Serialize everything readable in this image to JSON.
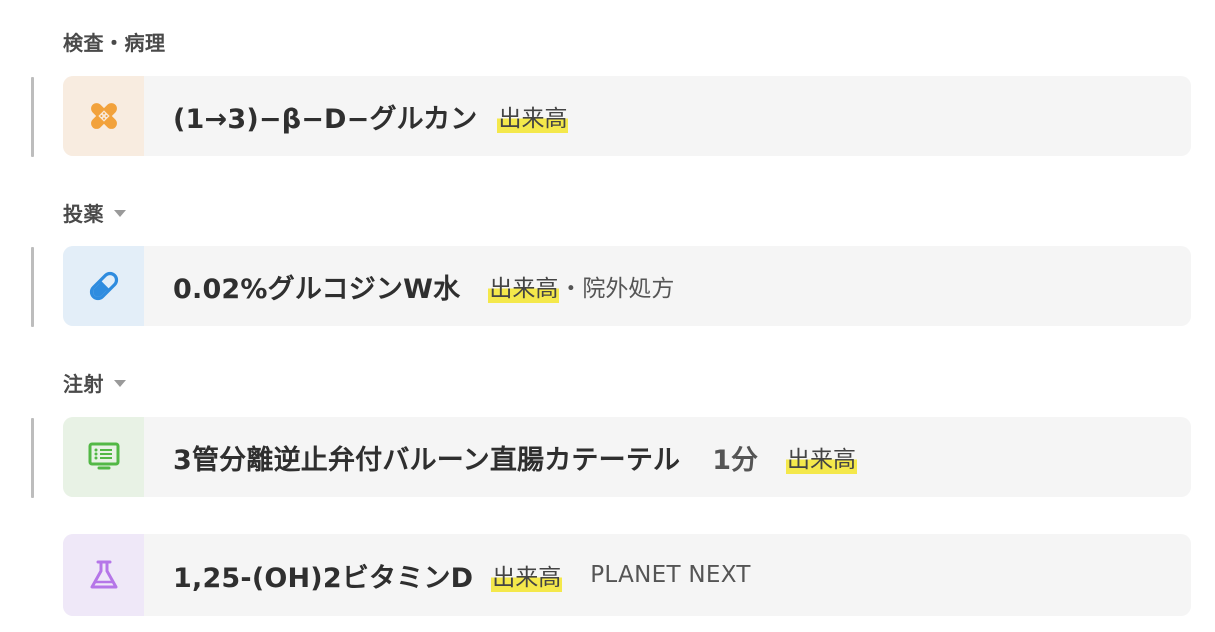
{
  "sections": [
    {
      "title": "検査・病理",
      "has_caret": false
    },
    {
      "title": "投薬",
      "has_caret": true
    },
    {
      "title": "注射",
      "has_caret": true
    }
  ],
  "cards": [
    {
      "icon": "bandage-icon",
      "accent": "#f2a23c",
      "name": "(1→3)−β−D−グルカン",
      "badge": "出来高"
    },
    {
      "icon": "pill-icon",
      "accent": "#2f8cdf",
      "name": "0.02%グルコジンW水",
      "badge": "出来高",
      "meta": "・院外処方"
    },
    {
      "icon": "monitor-list-icon",
      "accent": "#52b845",
      "name": "3管分離逆止弁付バルーン直腸カテーテル",
      "qty": "1分",
      "badge": "出来高"
    },
    {
      "icon": "flask-icon",
      "accent": "#b576e8",
      "name": "1,25-(OH)2ビタミンD",
      "badge": "出来高",
      "extra": "PLANET NEXT"
    }
  ],
  "colors": {
    "highlight": "#f4e84b",
    "card_background": "#f5f5f5",
    "section_title": "#4a4a4a"
  }
}
